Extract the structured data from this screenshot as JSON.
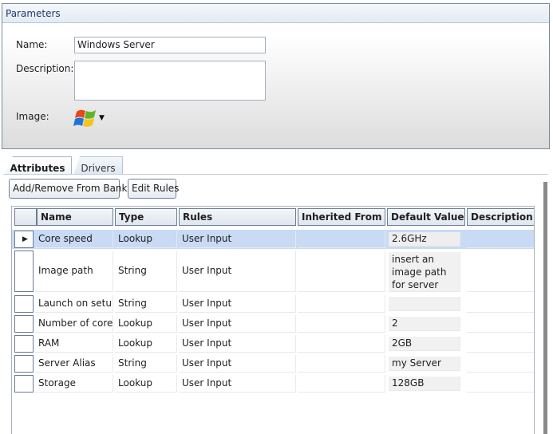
{
  "params": {
    "title": "Parameters",
    "name_label": "Name:",
    "name_value": "Windows Server",
    "description_label": "Description:",
    "description_value": "",
    "image_label": "Image:",
    "image_icon": "windows-logo-icon"
  },
  "tabs": [
    {
      "label": "Attributes",
      "active": true
    },
    {
      "label": "Drivers",
      "active": false
    }
  ],
  "toolbar": {
    "add_remove_label": "Add/Remove From Bank",
    "edit_rules_label": "Edit Rules"
  },
  "grid": {
    "columns": [
      "Name",
      "Type",
      "Rules",
      "Inherited From",
      "Default Value",
      "Description"
    ],
    "rows": [
      {
        "name": "Core speed",
        "type": "Lookup",
        "rules": "User Input",
        "inherited": "",
        "default": "2.6GHz",
        "description": "",
        "selected": true
      },
      {
        "name": "Image path",
        "type": "String",
        "rules": "User Input",
        "inherited": "",
        "default": "insert an image path for server configuration",
        "description": ""
      },
      {
        "name": "Launch on setup",
        "type": "String",
        "rules": "User Input",
        "inherited": "",
        "default": "",
        "description": ""
      },
      {
        "name": "Number of cores",
        "type": "Lookup",
        "rules": "User Input",
        "inherited": "",
        "default": "2",
        "description": ""
      },
      {
        "name": "RAM",
        "type": "Lookup",
        "rules": "User Input",
        "inherited": "",
        "default": "2GB",
        "description": ""
      },
      {
        "name": "Server Alias",
        "type": "String",
        "rules": "User Input",
        "inherited": "",
        "default": "my Server",
        "description": ""
      },
      {
        "name": "Storage",
        "type": "Lookup",
        "rules": "User Input",
        "inherited": "",
        "default": "128GB",
        "description": ""
      }
    ]
  }
}
